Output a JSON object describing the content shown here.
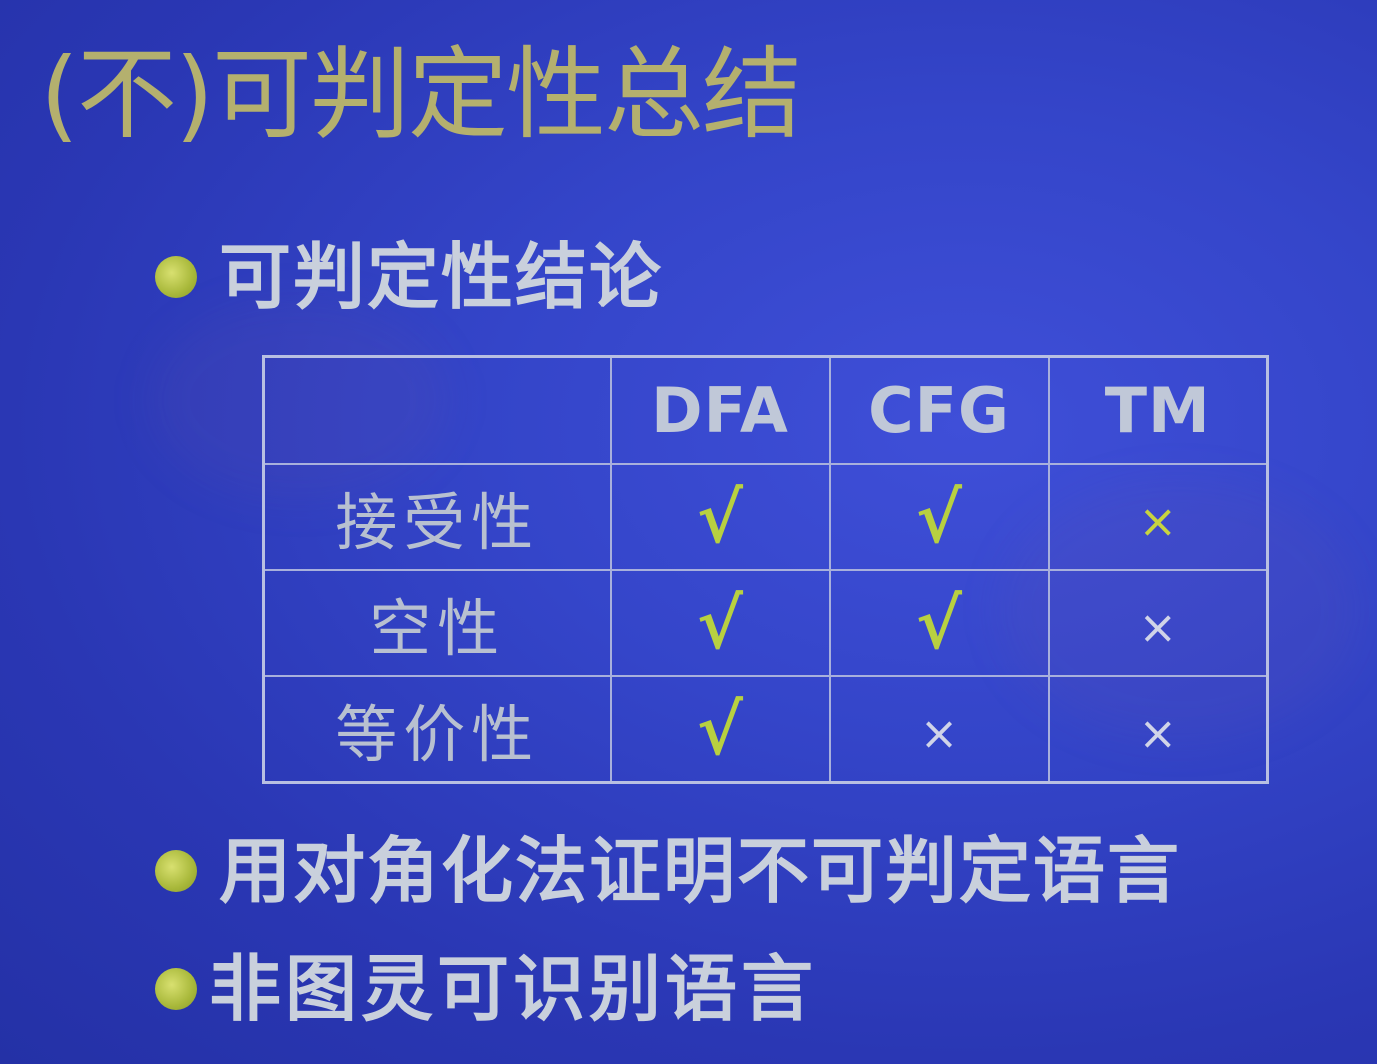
{
  "slide": {
    "title": "(不)可判定性总结",
    "bullets": [
      "可判定性结论",
      "用对角化法证明不可判定语言",
      "非图灵可识别语言"
    ],
    "table": {
      "headers": [
        "",
        "DFA",
        "CFG",
        "TM"
      ],
      "rows": [
        {
          "label": "接受性",
          "cells": [
            "√",
            "√",
            "×"
          ]
        },
        {
          "label": "空性",
          "cells": [
            "√",
            "√",
            "×"
          ]
        },
        {
          "label": "等价性",
          "cells": [
            "√",
            "×",
            "×"
          ]
        }
      ]
    }
  },
  "colors": {
    "background": "#3445c9",
    "title": "#b4b06e",
    "bullet_dot": "#a8b83a",
    "check": "#b8d040"
  }
}
